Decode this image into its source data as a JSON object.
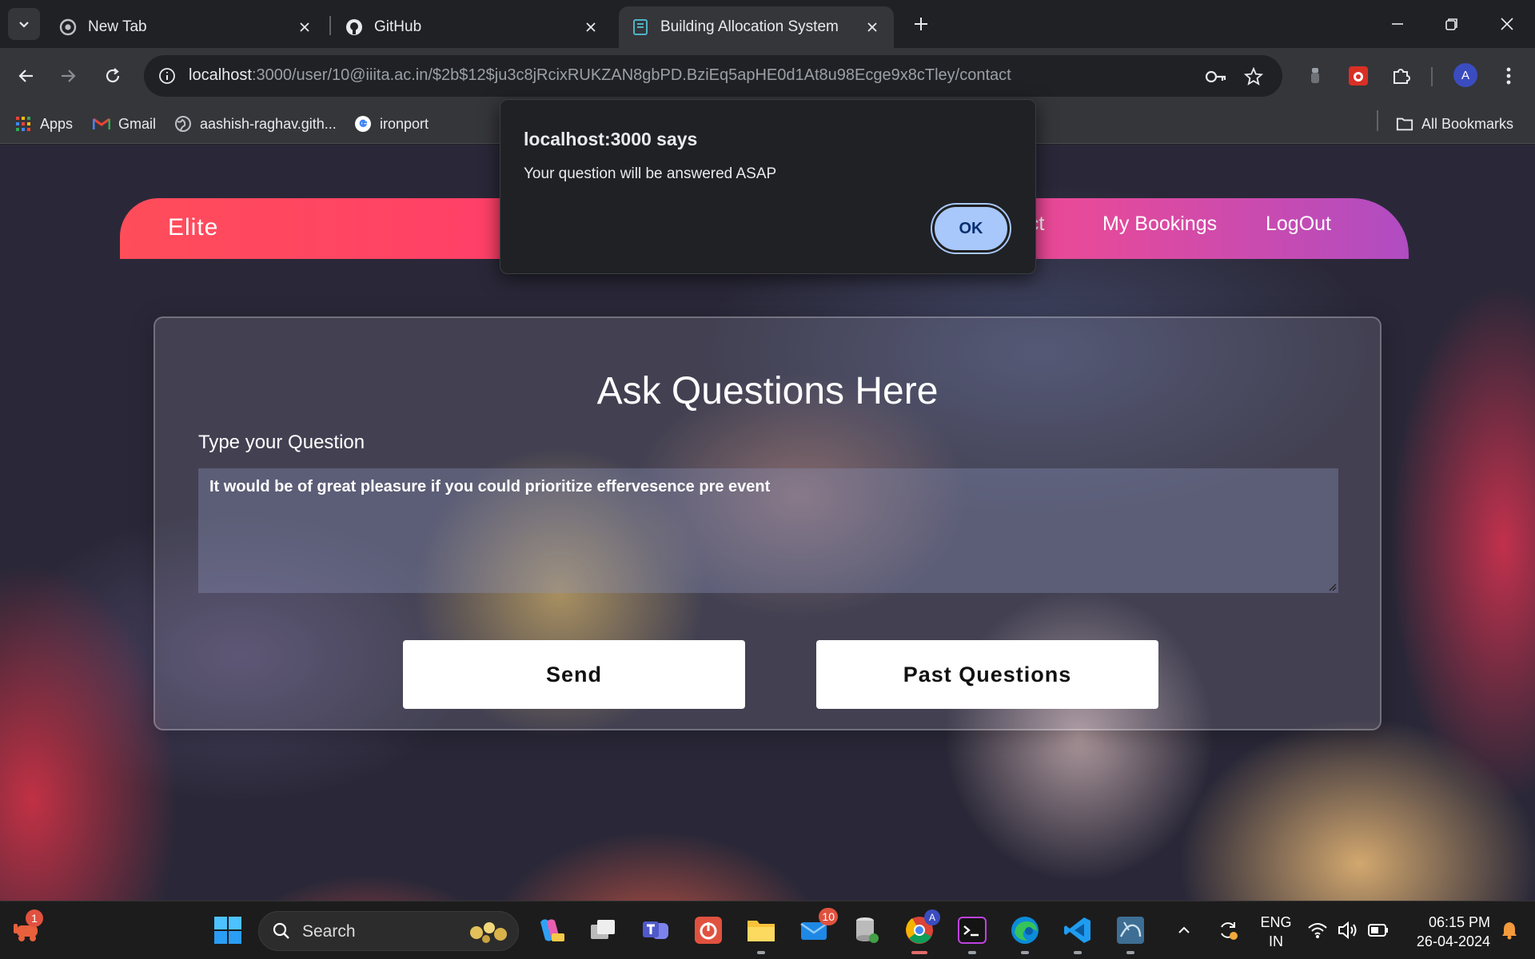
{
  "browser": {
    "tabs": [
      {
        "title": "New Tab",
        "favicon": "chrome-icon"
      },
      {
        "title": "GitHub",
        "favicon": "github-icon"
      },
      {
        "title": "Building Allocation System",
        "favicon": "page-icon",
        "active": true
      }
    ],
    "url_host": "localhost",
    "url_rest": ":3000/user/10@iiita.ac.in/$2b$12$ju3c8jRcixRUKZAN8gbPD.BziEq5apHE0d1At8u98Ecge9x8cTley/contact",
    "profile_initial": "A",
    "bookmarks": [
      {
        "label": "Apps",
        "icon": "apps-grid-icon"
      },
      {
        "label": "Gmail",
        "icon": "gmail-icon"
      },
      {
        "label": "aashish-raghav.gith...",
        "icon": "globe-icon"
      },
      {
        "label": "ironport",
        "icon": "google-icon"
      }
    ],
    "all_bookmarks": "All Bookmarks"
  },
  "site": {
    "brand": "Elite",
    "nav": [
      "act",
      "My Bookings",
      "LogOut"
    ]
  },
  "form": {
    "heading": "Ask Questions Here",
    "label": "Type your Question",
    "question_value": "It would be of great pleasure if you could prioritize effervesence pre event",
    "send_label": "Send",
    "past_label": "Past Questions"
  },
  "dialog": {
    "title": "localhost:3000 says",
    "message": "Your question will be answered ASAP",
    "ok_label": "OK"
  },
  "taskbar": {
    "search_placeholder": "Search",
    "notification_badge": "1",
    "mail_badge": "10",
    "lang_line1": "ENG",
    "lang_line2": "IN",
    "time": "06:15 PM",
    "date": "26-04-2024"
  },
  "colors": {
    "navbar_start": "#ff4d5a",
    "navbar_end": "#b04cc2",
    "dialog_ok": "#a8c7fa"
  }
}
